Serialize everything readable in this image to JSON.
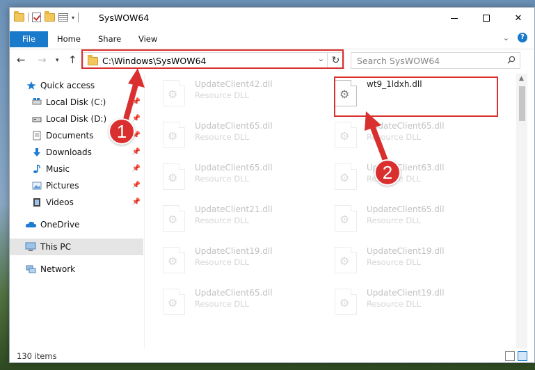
{
  "window": {
    "title": "SysWOW64",
    "minimize_label": "—",
    "maximize_label": "",
    "close_label": "✕"
  },
  "ribbon": {
    "tabs": [
      {
        "label": "File"
      },
      {
        "label": "Home"
      },
      {
        "label": "Share"
      },
      {
        "label": "View"
      }
    ]
  },
  "navbar": {
    "address": "C:\\Windows\\SysWOW64",
    "search_placeholder": "Search SysWOW64"
  },
  "sidebar": {
    "items": [
      {
        "label": "Quick access"
      },
      {
        "label": "Local Disk (C:)"
      },
      {
        "label": "Local Disk (D:)"
      },
      {
        "label": "Documents"
      },
      {
        "label": "Downloads"
      },
      {
        "label": "Music"
      },
      {
        "label": "Pictures"
      },
      {
        "label": "Videos"
      },
      {
        "label": "OneDrive"
      },
      {
        "label": "This PC"
      },
      {
        "label": "Network"
      }
    ]
  },
  "files": {
    "left": [
      {
        "name": "UpdateClient42.dll",
        "desc": "Resource DLL"
      },
      {
        "name": "UpdateClient65.dll",
        "desc": "Resource DLL"
      },
      {
        "name": "UpdateClient65.dll",
        "desc": "Resource DLL"
      },
      {
        "name": "UpdateClient21.dll",
        "desc": "Resource DLL"
      },
      {
        "name": "UpdateClient19.dll",
        "desc": "Resource DLL"
      },
      {
        "name": "UpdateClient65.dll",
        "desc": "Resource DLL"
      }
    ],
    "right": [
      {
        "name": "wt9_1ldxh.dll",
        "desc": ""
      },
      {
        "name": "UpdateClient65.dll",
        "desc": "Resource DLL"
      },
      {
        "name": "UpdateClient63.dll",
        "desc": "Resource DLL"
      },
      {
        "name": "UpdateClient65.dll",
        "desc": "Resource DLL"
      },
      {
        "name": "UpdateClient19.dll",
        "desc": "Resource DLL"
      },
      {
        "name": "UpdateClient19.dll",
        "desc": "Resource DLL"
      }
    ]
  },
  "status": {
    "items_count": "130 items"
  },
  "callouts": {
    "one": "1",
    "two": "2"
  },
  "colors": {
    "accent": "#1979ca",
    "highlight": "#d9302f",
    "selected_nav": "#e5e5e5"
  }
}
